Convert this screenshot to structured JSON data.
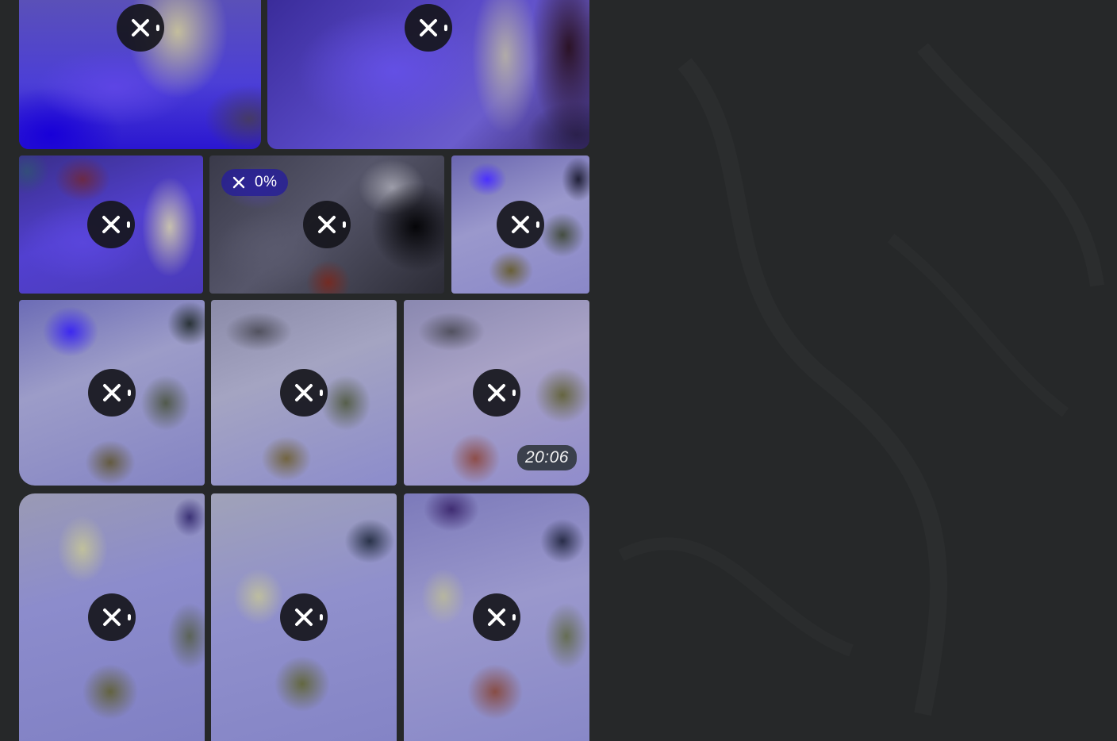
{
  "colors": {
    "background": "#262829",
    "button_bg": "#16161c",
    "progress_pill_bg": "#2820a0",
    "time_badge_bg": "#2d343a"
  },
  "icons": {
    "cancel": "close-icon",
    "spinner": "loading-spinner-icon"
  },
  "tiles": [
    {
      "name": "photo-1",
      "upload": {
        "progress": 0
      }
    },
    {
      "name": "photo-2",
      "upload": {
        "progress": 0
      }
    },
    {
      "name": "photo-3",
      "upload": {
        "progress": 0
      }
    },
    {
      "name": "photo-4",
      "upload": {
        "progress": 0,
        "progress_label": "0%"
      }
    },
    {
      "name": "photo-5",
      "upload": {
        "progress": 0
      }
    },
    {
      "name": "photo-6",
      "upload": {
        "progress": 0
      }
    },
    {
      "name": "photo-7",
      "upload": {
        "progress": 0
      }
    },
    {
      "name": "photo-8",
      "upload": {
        "progress": 0
      },
      "time": "20:06"
    },
    {
      "name": "photo-9",
      "upload": {
        "progress": 0
      }
    },
    {
      "name": "photo-10",
      "upload": {
        "progress": 0
      }
    },
    {
      "name": "photo-11",
      "upload": {
        "progress": 0
      }
    }
  ]
}
